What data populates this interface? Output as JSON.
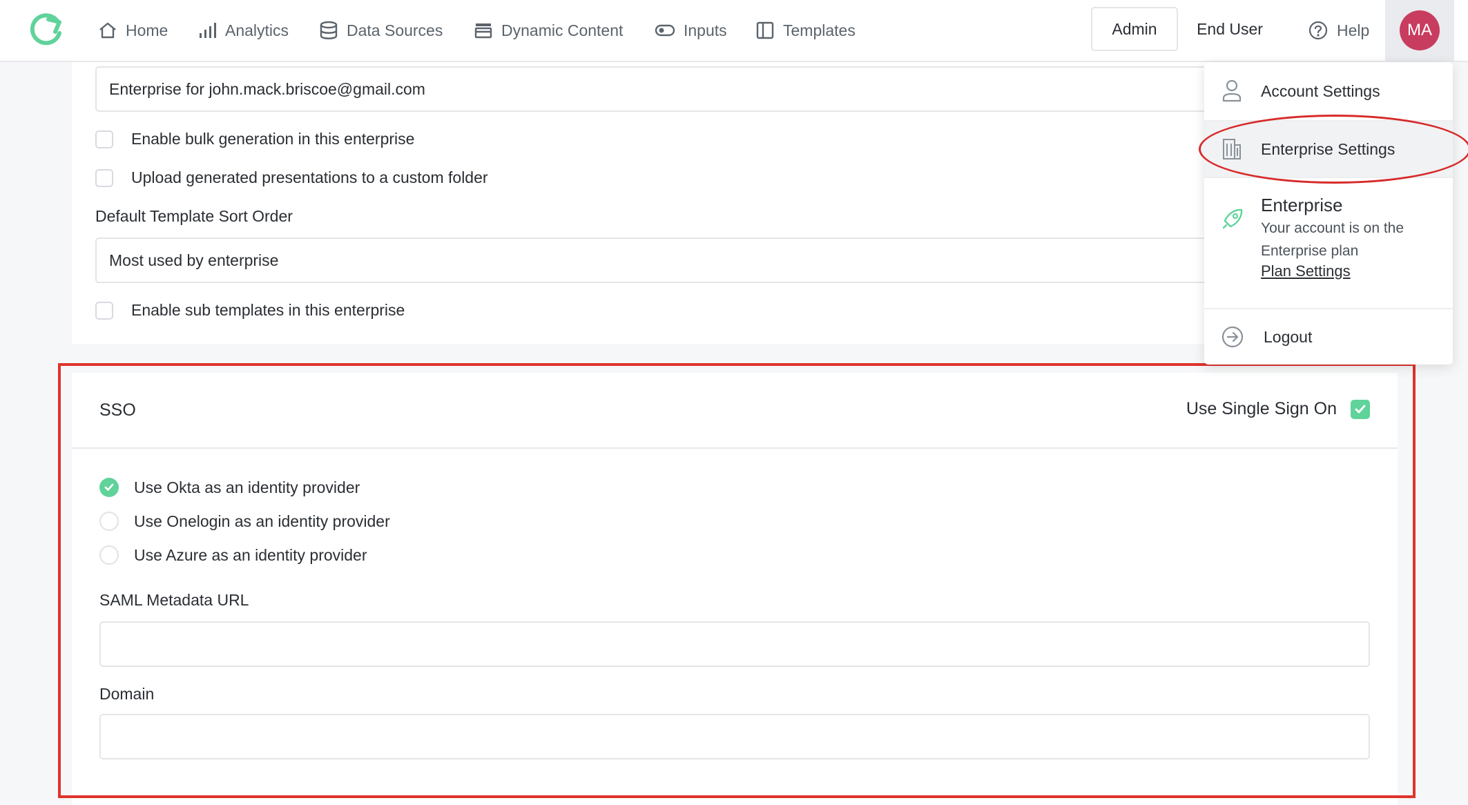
{
  "nav": {
    "items": [
      {
        "label": "Home",
        "icon": "home-icon"
      },
      {
        "label": "Analytics",
        "icon": "analytics-icon"
      },
      {
        "label": "Data Sources",
        "icon": "database-icon"
      },
      {
        "label": "Dynamic Content",
        "icon": "dynamic-content-icon"
      },
      {
        "label": "Inputs",
        "icon": "toggle-icon"
      },
      {
        "label": "Templates",
        "icon": "templates-icon"
      }
    ],
    "admin": "Admin",
    "end_user": "End User",
    "help": "Help",
    "avatar_initials": "MA"
  },
  "enterprise": {
    "name_value": "Enterprise for john.mack.briscoe@gmail.com",
    "bulk_generation_label": "Enable bulk generation in this enterprise",
    "upload_custom_folder_label": "Upload generated presentations to a custom folder",
    "sort_order_label": "Default Template Sort Order",
    "sort_order_value": "Most used by enterprise",
    "sub_templates_label": "Enable sub templates in this enterprise"
  },
  "sso": {
    "title": "SSO",
    "toggle_label": "Use Single Sign On",
    "toggle_checked": true,
    "providers": [
      {
        "label": "Use Okta as an identity provider",
        "selected": true
      },
      {
        "label": "Use Onelogin as an identity provider",
        "selected": false
      },
      {
        "label": "Use Azure as an identity provider",
        "selected": false
      }
    ],
    "saml_label": "SAML Metadata URL",
    "saml_value": "",
    "domain_label": "Domain",
    "domain_value": ""
  },
  "dropdown": {
    "account_settings": "Account Settings",
    "enterprise_settings": "Enterprise Settings",
    "plan_title": "Enterprise",
    "plan_desc": "Your account is on the Enterprise plan",
    "plan_link": "Plan Settings",
    "logout": "Logout"
  },
  "colors": {
    "accent_green": "#5fd39a",
    "avatar_bg": "#c83c5f",
    "highlight_red": "#e0332b"
  }
}
